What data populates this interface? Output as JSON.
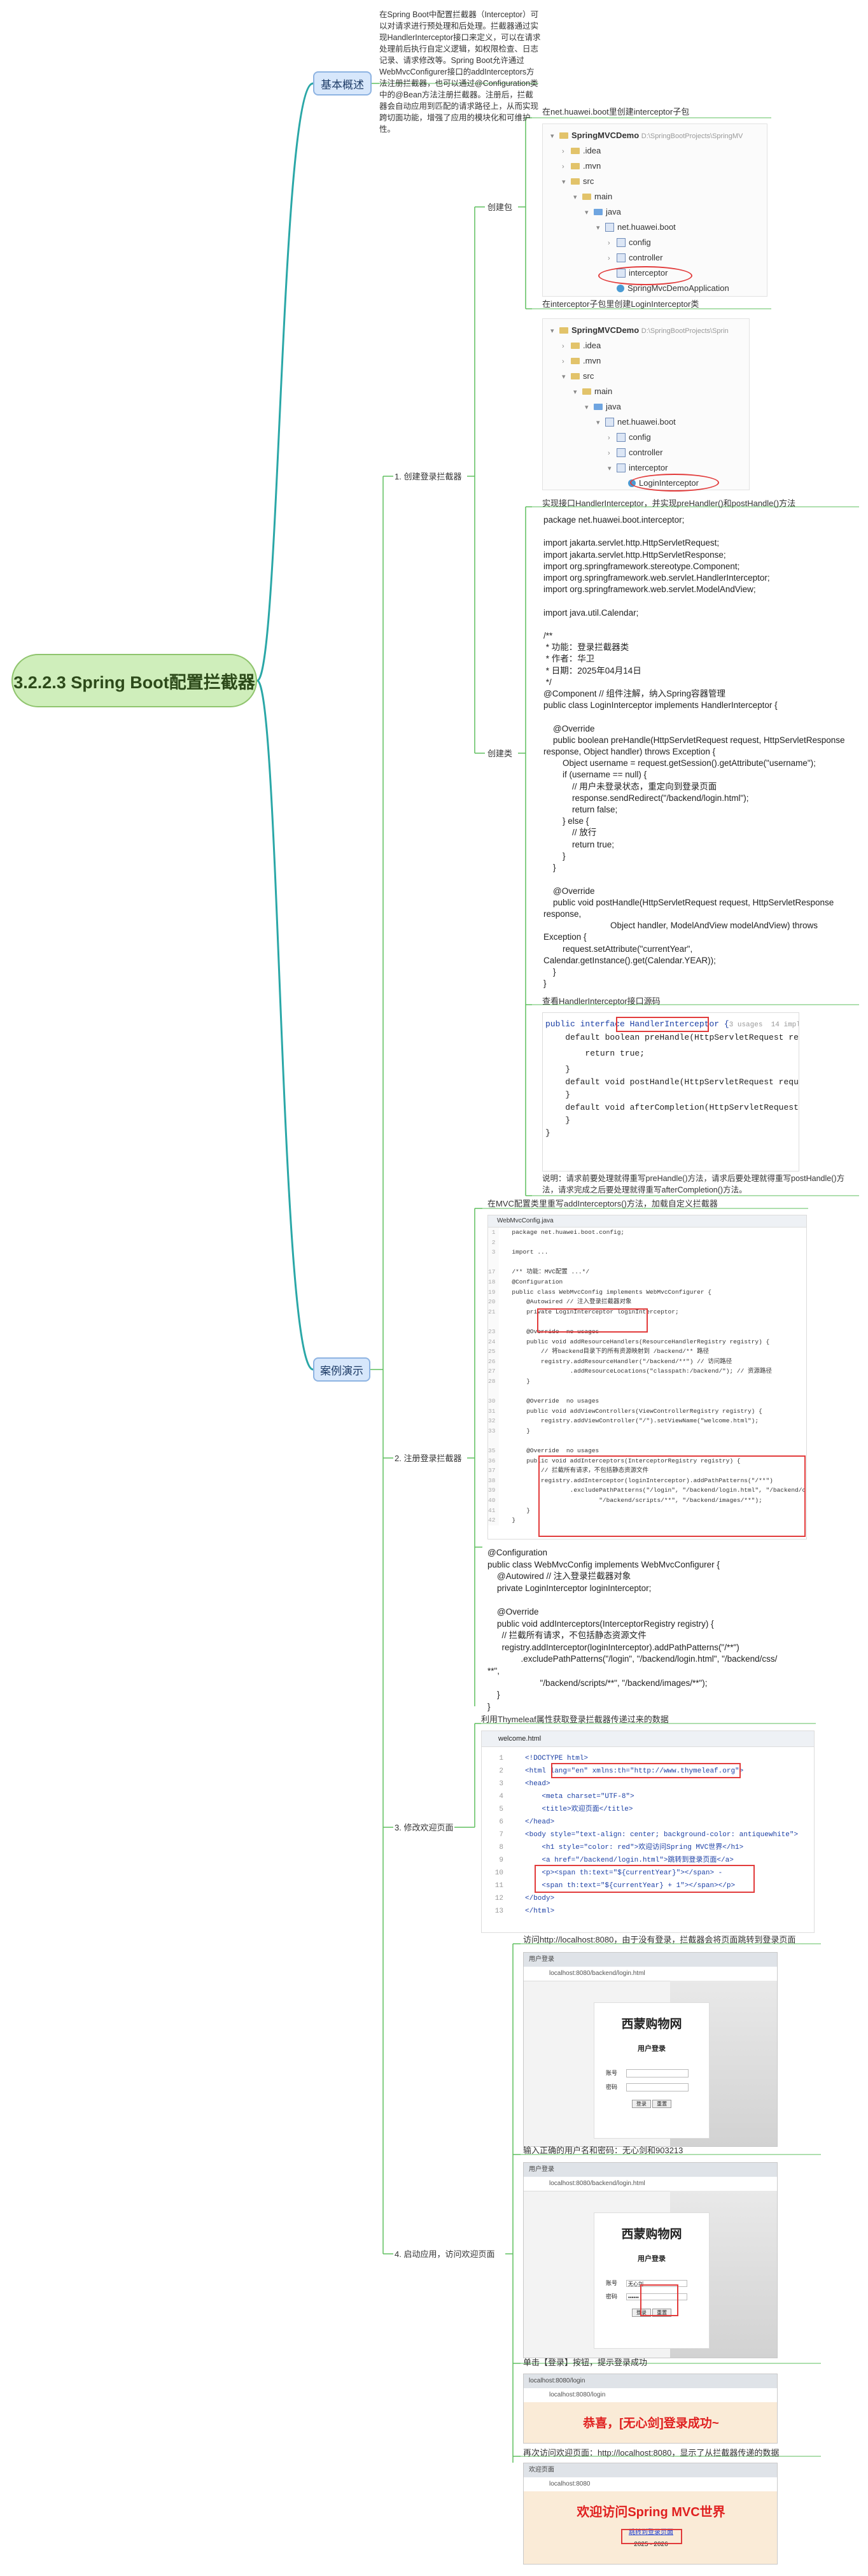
{
  "root": {
    "title": "3.2.2.3 Spring Boot配置拦截器"
  },
  "overview": {
    "label": "基本概述",
    "text": "在Spring Boot中配置拦截器（Interceptor）可以对请求进行预处理和后处理。拦截器通过实现HandlerInterceptor接口来定义，可以在请求处理前后执行自定义逻辑，如权限检查、日志记录、请求修改等。Spring Boot允许通过WebMvcConfigurer接口的addInterceptors方法注册拦截器，也可以通过@Configuration类中的@Bean方法注册拦截器。注册后，拦截器会自动应用到匹配的请求路径上，从而实现跨切面功能，增强了应用的模块化和可维护性。"
  },
  "demo": {
    "label": "案例演示",
    "steps": [
      "1. 创建登录拦截器",
      "2. 注册登录拦截器",
      "3. 修改欢迎页面",
      "4. 启动应用，访问欢迎页面"
    ]
  },
  "step1": {
    "create_package": "创建包",
    "create_class": "创建类",
    "pkg_title": "在net.huawei.boot里创建interceptor子包",
    "tree1": {
      "project": "SpringMVCDemo",
      "path": "D:\\SpringBootProjects\\SpringMV",
      "items": [
        ".idea",
        ".mvn",
        "src",
        "main",
        "java",
        "net.huawei.boot",
        "config",
        "controller",
        "interceptor",
        "SpringMvcDemoApplication"
      ]
    },
    "cls_title": "在interceptor子包里创建LoginInterceptor类",
    "tree2": {
      "project": "SpringMVCDemo",
      "path": "D:\\SpringBootProjects\\Sprin",
      "items": [
        ".idea",
        ".mvn",
        "src",
        "main",
        "java",
        "net.huawei.boot",
        "config",
        "controller",
        "interceptor",
        "LoginInterceptor"
      ]
    },
    "impl_title": "实现接口HandlerInterceptor，并实现preHandler()和postHandle()方法",
    "code": "package net.huawei.boot.interceptor;\n\nimport jakarta.servlet.http.HttpServletRequest;\nimport jakarta.servlet.http.HttpServletResponse;\nimport org.springframework.stereotype.Component;\nimport org.springframework.web.servlet.HandlerInterceptor;\nimport org.springframework.web.servlet.ModelAndView;\n\nimport java.util.Calendar;\n\n/**\n * 功能：登录拦截器类\n * 作者：华卫\n * 日期：2025年04月14日\n */\n@Component // 组件注解，纳入Spring容器管理\npublic class LoginInterceptor implements HandlerInterceptor {\n\n    @Override\n    public boolean preHandle(HttpServletRequest request, HttpServletResponse\nresponse, Object handler) throws Exception {\n        Object username = request.getSession().getAttribute(\"username\");\n        if (username == null) {\n            // 用户未登录状态，重定向到登录页面\n            response.sendRedirect(\"/backend/login.html\");\n            return false;\n        } else {\n            // 放行\n            return true;\n        }\n    }\n\n    @Override\n    public void postHandle(HttpServletRequest request, HttpServletResponse\nresponse,\n                            Object handler, ModelAndView modelAndView) throws\nException {\n        request.setAttribute(\"currentYear\",\nCalendar.getInstance().get(Calendar.YEAR));\n    }\n}",
    "iface_title": "查看HandlerInterceptor接口源码",
    "iface": {
      "usages": "3 usages  14 impleme",
      "lines": [
        "public interface HandlerInterceptor {",
        "    default boolean preHandle(HttpServletRequest request",
        "        return true;",
        "    }",
        "",
        "    default void postHandle(HttpServletRequest request,",
        "    }",
        "",
        "    default void afterCompletion(HttpServletRequest requ",
        "    }",
        "}"
      ]
    },
    "explain": "说明：请求前要处理就得重写preHandle()方法，请求后要处理就得重写postHandle()方法，请求完成之后要处理就得重写afterCompletion()方法。"
  },
  "step2": {
    "title": "在MVC配置类里重写addInterceptors()方法，加载自定义拦截器",
    "tab": "WebMvcConfig.java",
    "lines": [
      "package net.huawei.boot.config;",
      "",
      "import ...",
      "",
      "/** 功能：MVC配置 ...*/",
      "@Configuration",
      "public class WebMvcConfig implements WebMvcConfigurer {",
      "    @Autowired // 注入登录拦截器对象",
      "    private LoginInterceptor loginInterceptor;",
      "",
      "    @Override  no usages",
      "    public void addResourceHandlers(ResourceHandlerRegistry registry) {",
      "        // 将backend目录下的所有资源映射到 /backend/** 路径",
      "        registry.addResourceHandler(\"/backend/**\") // 访问路径",
      "                .addResourceLocations(\"classpath:/backend/\"); // 资源路径",
      "    }",
      "",
      "    @Override  no usages",
      "    public void addViewControllers(ViewControllerRegistry registry) {",
      "        registry.addViewController(\"/\").setViewName(\"welcome.html\");",
      "    }",
      "",
      "    @Override  no usages",
      "    public void addInterceptors(InterceptorRegistry registry) {",
      "        // 拦截所有请求，不包括静态资源文件",
      "        registry.addInterceptor(loginInterceptor).addPathPatterns(\"/**\")",
      "                .excludePathPatterns(\"/login\", \"/backend/login.html\", \"/backend/css/**\",",
      "                        \"/backend/scripts/**\", \"/backend/images/**\");",
      "    }",
      "}"
    ],
    "line_numbers": [
      "1",
      "2",
      "3",
      "",
      "17",
      "18",
      "19",
      "20",
      "21",
      "",
      "23",
      "24",
      "25",
      "26",
      "27",
      "28",
      "",
      "30",
      "31",
      "32",
      "33",
      "",
      "35",
      "36",
      "37",
      "38",
      "39",
      "40",
      "41",
      "42"
    ],
    "code": "@Configuration\npublic class WebMvcConfig implements WebMvcConfigurer {\n    @Autowired // 注入登录拦截器对象\n    private LoginInterceptor loginInterceptor;\n\n    @Override\n    public void addInterceptors(InterceptorRegistry registry) {\n      // 拦截所有请求，不包括静态资源文件\n      registry.addInterceptor(loginInterceptor).addPathPatterns(\"/**\")\n              .excludePathPatterns(\"/login\", \"/backend/login.html\", \"/backend/css/\n**\",\n                      \"/backend/scripts/**\", \"/backend/images/**\");\n    }\n}"
  },
  "step3": {
    "title": "利用Thymeleaf属性获取登录拦截器传递过来的数据",
    "tab": "welcome.html",
    "lines": [
      "<!DOCTYPE html>",
      "<html lang=\"en\" xmlns:th=\"http://www.thymeleaf.org\">",
      "<head>",
      "    <meta charset=\"UTF-8\">",
      "    <title>欢迎页面</title>",
      "</head>",
      "<body style=\"text-align: center; background-color: antiquewhite\">",
      "    <h1 style=\"color: red\">欢迎访问Spring MVC世界</h1>",
      "    <a href=\"/backend/login.html\">跳转到登录页面</a>",
      "    <p><span th:text=\"${currentYear}\"></span> -",
      "    <span th:text=\"${currentYear} + 1\"></span></p>",
      "</body>",
      "</html>"
    ]
  },
  "step4": {
    "title1": "访问http://localhost:8080，由于没有登录，拦截器会将页面跳转到登录页面",
    "title2": "输入正确的用户名和密码：无心剑和903213",
    "title3": "单击【登录】按钮，提示登录成功",
    "title4": "再次访问欢迎页面：http://localhost:8080，显示了从拦截器传递的数据",
    "tab_login": "用户登录",
    "url_login": "localhost:8080/backend/login.html",
    "shop": "西蒙购物网",
    "login_title": "用户登录",
    "username_label": "账号",
    "password_label": "密码",
    "username_value": "无心剑",
    "password_value": "••••••",
    "login_btn": "登录",
    "reset_btn": "重置",
    "tab_success": "localhost:8080/login",
    "url_success": "localhost:8080/login",
    "success_msg": "恭喜，[无心剑]登录成功~",
    "tab_welcome": "欢迎页面",
    "url_welcome": "localhost:8080",
    "welcome_msg": "欢迎访问Spring MVC世界",
    "welcome_link": "跳转到登录页面",
    "year_text": "2025 - 2026"
  },
  "colors": {
    "root_fill": "#cfeebb",
    "main_fill": "#d7e7fb",
    "line": "#2aa7a7",
    "highlight": "#e23b3b"
  }
}
